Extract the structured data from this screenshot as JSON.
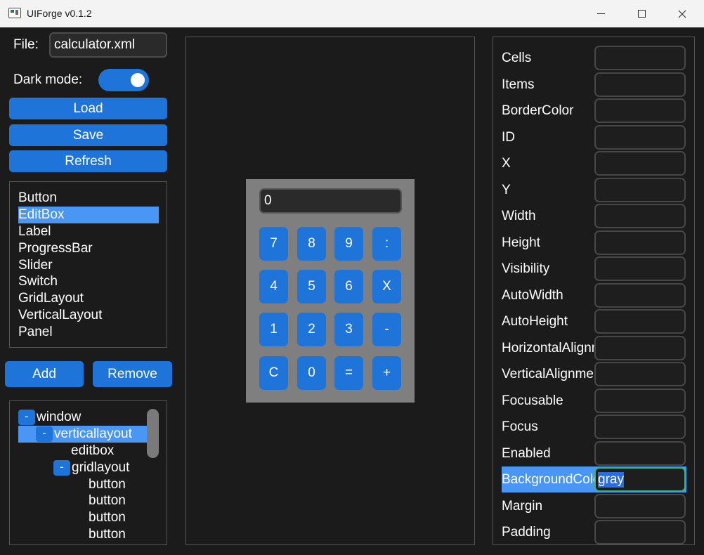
{
  "window": {
    "title": "UIForge v0.1.2"
  },
  "toolbar": {
    "file_label": "File:",
    "file_value": "calculator.xml",
    "dark_mode_label": "Dark mode:",
    "dark_mode_on": true,
    "load_label": "Load",
    "save_label": "Save",
    "refresh_label": "Refresh",
    "add_label": "Add",
    "remove_label": "Remove"
  },
  "widget_list": {
    "items": [
      "Button",
      "EditBox",
      "Label",
      "ProgressBar",
      "Slider",
      "Switch",
      "GridLayout",
      "VerticalLayout",
      "Panel"
    ],
    "selected": "EditBox"
  },
  "tree": {
    "toggle_symbol": "-",
    "nodes": [
      {
        "label": "window",
        "expanded": true
      },
      {
        "label": "verticallayout",
        "expanded": true,
        "selected": true
      },
      {
        "label": "editbox"
      },
      {
        "label": "gridlayout",
        "expanded": true
      },
      {
        "label": "button"
      },
      {
        "label": "button"
      },
      {
        "label": "button"
      },
      {
        "label": "button"
      }
    ]
  },
  "calculator": {
    "display": "0",
    "keys": [
      [
        "7",
        "8",
        "9",
        ":"
      ],
      [
        "4",
        "5",
        "6",
        "X"
      ],
      [
        "1",
        "2",
        "3",
        "-"
      ],
      [
        "C",
        "0",
        "=",
        "+"
      ]
    ]
  },
  "properties": {
    "rows": [
      {
        "label": "Cells",
        "value": ""
      },
      {
        "label": "Items",
        "value": ""
      },
      {
        "label": "BorderColor",
        "value": ""
      },
      {
        "label": "ID",
        "value": ""
      },
      {
        "label": "X",
        "value": ""
      },
      {
        "label": "Y",
        "value": ""
      },
      {
        "label": "Width",
        "value": ""
      },
      {
        "label": "Height",
        "value": ""
      },
      {
        "label": "Visibility",
        "value": ""
      },
      {
        "label": "AutoWidth",
        "value": ""
      },
      {
        "label": "AutoHeight",
        "value": ""
      },
      {
        "label": "HorizontalAlignment",
        "value": ""
      },
      {
        "label": "VerticalAlignment",
        "value": ""
      },
      {
        "label": "Focusable",
        "value": ""
      },
      {
        "label": "Focus",
        "value": ""
      },
      {
        "label": "Enabled",
        "value": ""
      },
      {
        "label": "BackgroundColor",
        "value": "gray",
        "selected": true
      },
      {
        "label": "Margin",
        "value": ""
      },
      {
        "label": "Padding",
        "value": ""
      }
    ]
  },
  "colors": {
    "accent": "#1e74d8",
    "selection": "#4a96f5",
    "background": "#1b1b1b",
    "canvas_widget": "#7f7f7f",
    "active_field_border": "#3bb273"
  }
}
